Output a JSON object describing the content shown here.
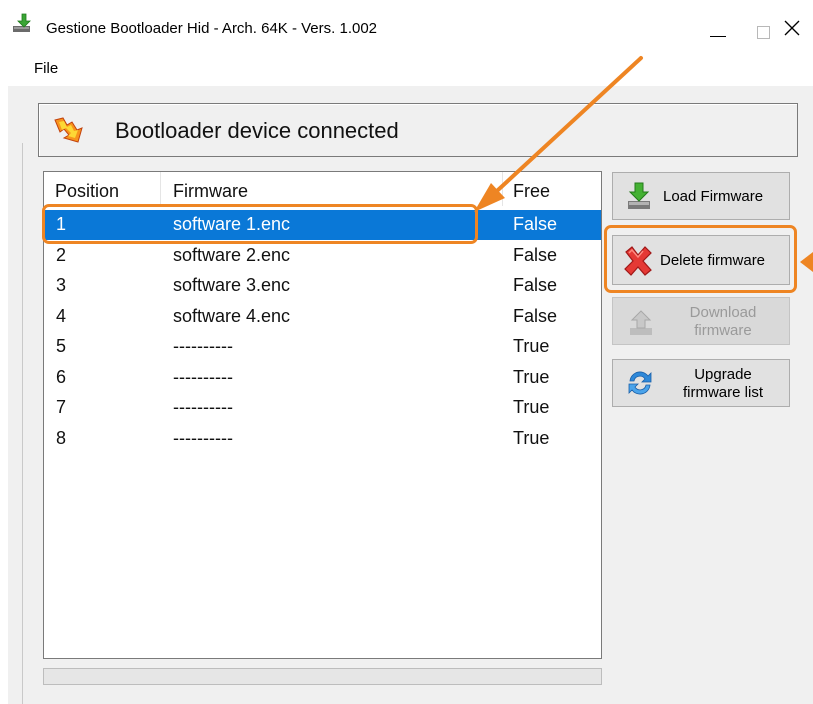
{
  "window": {
    "title": "Gestione Bootloader Hid - Arch. 64K - Vers. 1.002",
    "controls": {
      "minimize": "—",
      "maximize": "☐",
      "close": "✕"
    }
  },
  "menu": {
    "file": "File"
  },
  "status": {
    "text": "Bootloader device connected",
    "icon": "lightning-warning-icon"
  },
  "table": {
    "headers": {
      "position": "Position",
      "firmware": "Firmware",
      "free": "Free"
    },
    "rows": [
      {
        "position": "1",
        "firmware": "software 1.enc",
        "free": "False"
      },
      {
        "position": "2",
        "firmware": "software 2.enc",
        "free": "False"
      },
      {
        "position": "3",
        "firmware": "software 3.enc",
        "free": "False"
      },
      {
        "position": "4",
        "firmware": "software 4.enc",
        "free": "False"
      },
      {
        "position": "5",
        "firmware": "----------",
        "free": "True"
      },
      {
        "position": "6",
        "firmware": "----------",
        "free": "True"
      },
      {
        "position": "7",
        "firmware": "----------",
        "free": "True"
      },
      {
        "position": "8",
        "firmware": "----------",
        "free": "True"
      }
    ],
    "selected_row": 1
  },
  "buttons": {
    "load": {
      "label": "Load Firmware",
      "icon": "download-green-arrow-icon"
    },
    "delete": {
      "label": "Delete firmware",
      "icon": "red-x-icon"
    },
    "download": {
      "label_line1": "Download",
      "label_line2": "firmware",
      "icon": "upload-arrow-icon",
      "enabled": false
    },
    "upgrade": {
      "label_line1": "Upgrade",
      "label_line2": "firmware list",
      "icon": "refresh-icon"
    }
  },
  "colors": {
    "selection": "#0a78d7",
    "annotation": "#ee8523",
    "panel_bg": "#f0f0f0"
  }
}
